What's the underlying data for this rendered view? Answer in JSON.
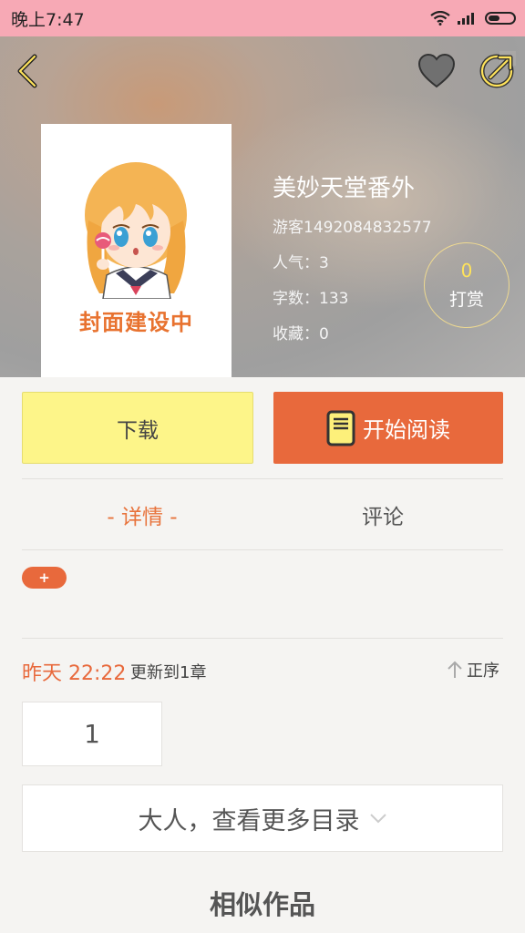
{
  "status_bar": {
    "time": "晚上7:47",
    "icons": [
      "wifi-icon",
      "signal-icon",
      "battery-icon"
    ],
    "background": "#f7a9b5"
  },
  "header": {
    "back_icon": "chevron-left-icon",
    "favorite_icon": "heart-icon",
    "share_icon": "share-icon"
  },
  "book": {
    "cover_text": "封面建设中",
    "title": "美妙天堂番外",
    "author": "游客1492084832577",
    "popularity": "人气：3",
    "word_count": "字数：133",
    "favorites": "收藏：0"
  },
  "tip": {
    "count": "0",
    "label": "打赏"
  },
  "actions": {
    "download_label": "下载",
    "read_label": "开始阅读",
    "read_icon": "book-icon",
    "download_color": "#fdf589",
    "read_color": "#e8693c"
  },
  "tabs": {
    "details": "- 详情 -",
    "comments": "评论"
  },
  "tags": {
    "add_label": "+"
  },
  "chapters": {
    "update_time": "昨天 22:22",
    "update_text": "更新到1章",
    "order_label": "正序",
    "items": [
      "1"
    ],
    "more_label": "大人，查看更多目录"
  },
  "similar": {
    "title": "相似作品"
  },
  "accent_color": "#e8693c"
}
